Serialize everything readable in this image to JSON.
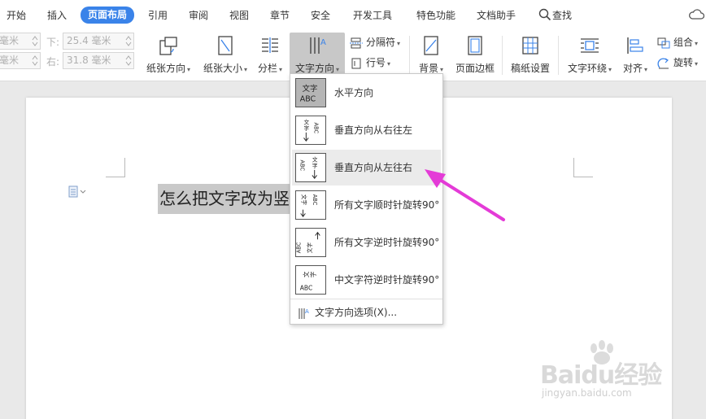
{
  "menubar": {
    "tabs": [
      {
        "label": "开始"
      },
      {
        "label": "插入"
      },
      {
        "label": "页面布局",
        "active": true
      },
      {
        "label": "引用"
      },
      {
        "label": "审阅"
      },
      {
        "label": "视图"
      },
      {
        "label": "章节"
      },
      {
        "label": "安全"
      },
      {
        "label": "开发工具"
      },
      {
        "label": "特色功能"
      },
      {
        "label": "文档助手"
      }
    ],
    "search_label": "查找"
  },
  "ribbon": {
    "margins": {
      "top_unit": "毫米",
      "left_unit": "毫米",
      "bottom_label": "下:",
      "bottom_value": "25.4 毫米",
      "right_label": "右:",
      "right_value": "31.8 毫米"
    },
    "buttons": {
      "orientation": "纸张方向",
      "size": "纸张大小",
      "columns": "分栏",
      "text_direction": "文字方向",
      "separator": "分隔符",
      "line_number": "行号",
      "background": "背景",
      "page_border": "页面边框",
      "grid_paper": "稿纸设置",
      "text_wrap": "文字环绕",
      "align": "对齐",
      "group": "组合",
      "rotate": "旋转"
    }
  },
  "document": {
    "text": "怎么把文字改为竖"
  },
  "dropdown": {
    "items": [
      {
        "label": "水平方向",
        "thumb": "文字\nABC"
      },
      {
        "label": "垂直方向从右往左",
        "thumb": "ABC/文字"
      },
      {
        "label": "垂直方向从左往右",
        "thumb": "文字/ABC"
      },
      {
        "label": "所有文字顺时针旋转90°",
        "thumb": "rot-cw"
      },
      {
        "label": "所有文字逆时针旋转90°",
        "thumb": "rot-ccw"
      },
      {
        "label": "中文字符逆时针旋转90°",
        "thumb": "cjk-ccw"
      }
    ],
    "options_label": "文字方向选项(X)..."
  },
  "watermark": {
    "brand": "Baidu经验",
    "url": "jingyan.baidu.com"
  },
  "colors": {
    "accent": "#3a83e9",
    "arrow": "#e43bd7",
    "pressed": "#c8c8c8"
  }
}
